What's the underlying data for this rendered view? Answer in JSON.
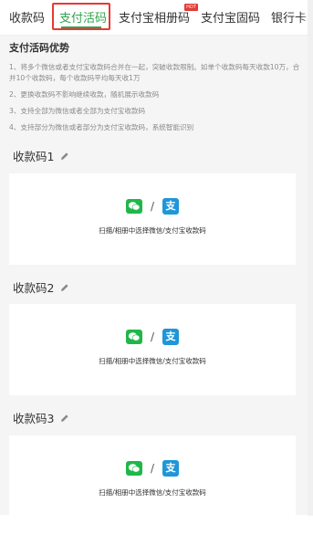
{
  "tabs": [
    {
      "label": "收款码"
    },
    {
      "label": "支付活码"
    },
    {
      "label": "支付宝相册码"
    },
    {
      "label": "支付宝固码"
    },
    {
      "label": "银行卡"
    }
  ],
  "hot_badge": "HOT",
  "advantages": {
    "title": "支付活码优势",
    "items": [
      "1、将多个微信或者支付宝收款码合并在一起，突破收款限制。如单个收款码每天收款10万，合并10个收款码，每个收款码平均每天收1万",
      "2、更换收款码不影响继续收款，随机展示收款码",
      "3、支持全部为微信或者全部为支付宝收款码",
      "4、支持部分为微信或者部分为支付宝收款码，系统智能识别"
    ]
  },
  "codes": [
    {
      "label": "收款码1",
      "caption": "扫描/相册中选择微信/支付宝收款码"
    },
    {
      "label": "收款码2",
      "caption": "扫描/相册中选择微信/支付宝收款码"
    },
    {
      "label": "收款码3",
      "caption": "扫描/相册中选择微信/支付宝收款码"
    }
  ],
  "separator": "/",
  "alipay_glyph": "支",
  "icons": {
    "edit": "pencil-icon",
    "wechat": "wechat-icon",
    "alipay": "alipay-icon"
  },
  "colors": {
    "active_tab": "#2ea44f",
    "highlight": "#e53935",
    "wechat": "#20b74a",
    "alipay": "#1f96d8"
  }
}
